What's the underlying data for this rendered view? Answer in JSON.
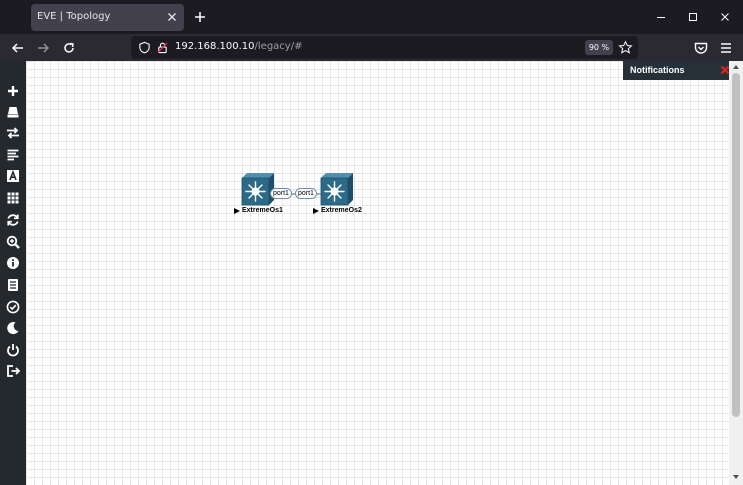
{
  "browser": {
    "tab_title": "EVE | Topology",
    "url_host": "192.168.100.10",
    "url_path": "/legacy/#",
    "zoom": "90 %"
  },
  "notifications": {
    "title": "Notifications"
  },
  "sidebar": {
    "icons": [
      "add-icon",
      "nodes-icon",
      "networks-icon",
      "startup-configs-icon",
      "text-icon",
      "status-grid-icon",
      "refresh-icon",
      "zoom-icon",
      "info-icon",
      "lab-details-icon",
      "checkmark-icon",
      "dark-mode-icon",
      "power-icon",
      "logout-icon"
    ]
  },
  "topology": {
    "nodes": [
      {
        "name": "ExtremeOs1",
        "port": "port1"
      },
      {
        "name": "ExtremeOs2",
        "port": "port1"
      }
    ]
  },
  "colors": {
    "node_icon": "#2c6a88",
    "sidebar": "#23292d",
    "notification_bar": "#253039",
    "close_red": "#e02020"
  }
}
